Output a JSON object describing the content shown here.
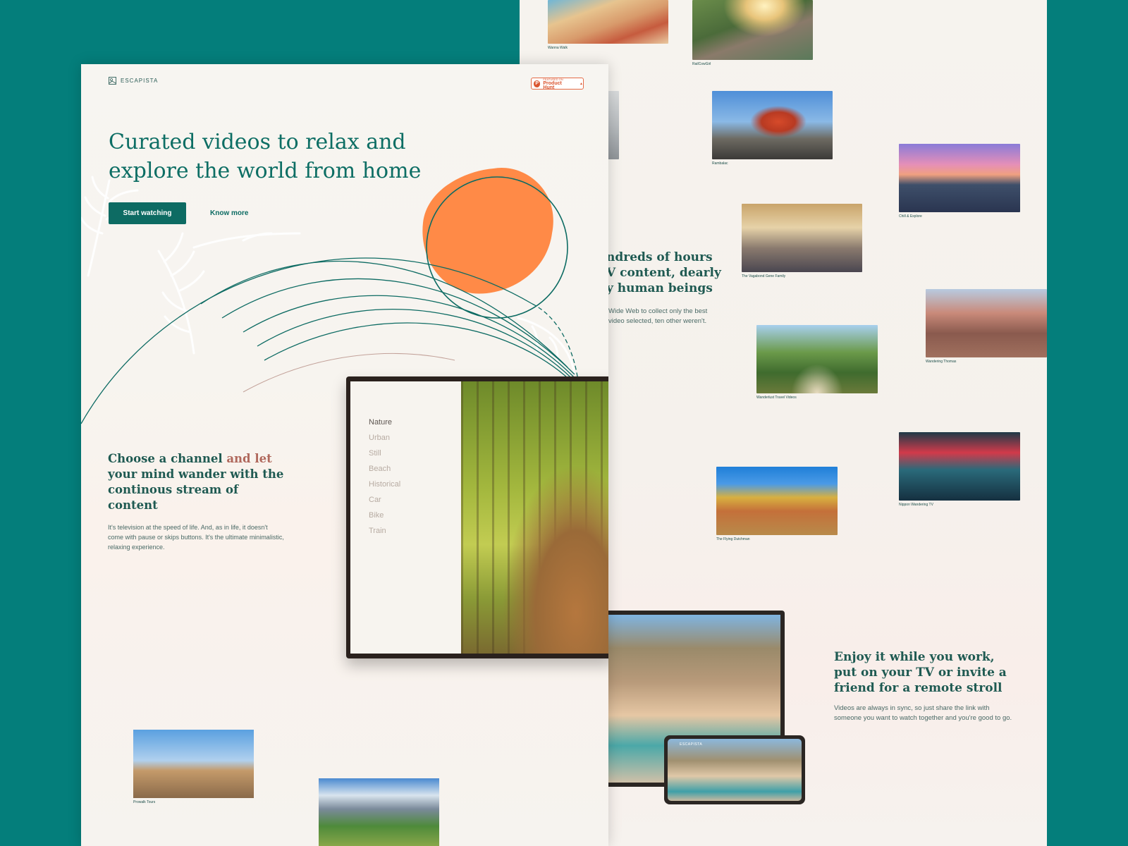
{
  "front": {
    "brand": "ESCAPISTA",
    "product_hunt": {
      "small": "FEATURED ON",
      "big": "Product Hunt",
      "votes": "▲"
    },
    "hero": {
      "title": "Curated videos to relax and explore the world from home",
      "cta_primary": "Start watching",
      "cta_secondary": "Know more"
    },
    "channels_section": {
      "heading_part1": "Choose a channel ",
      "heading_accent": "and let",
      "heading_part2": " your mind wander with the continous stream of content",
      "paragraph": "It's television at the speed of life. And, as in life, it doesn't come with pause or skips buttons. It's the ultimate minimalistic, relaxing experience."
    },
    "channel_menu": [
      "Nature",
      "Urban",
      "Still",
      "Beach",
      "Historical",
      "Car",
      "Bike",
      "Train"
    ],
    "active_channel": "Nature",
    "bottom_thumbs": [
      {
        "caption": "Prowalk Tours"
      },
      {
        "caption": ""
      }
    ]
  },
  "back": {
    "thumbs": [
      {
        "caption": "Wanna Walk"
      },
      {
        "caption": "RailCowGirl"
      },
      {
        "caption": ""
      },
      {
        "caption": "Rambalac"
      },
      {
        "caption": "Chill & Explore"
      },
      {
        "caption": "The Vagabond Gene Family"
      },
      {
        "caption": "Wandering Thomas"
      },
      {
        "caption": "Wanderlust Travel Videos"
      },
      {
        "caption": "Nippon Wandering TV"
      },
      {
        "caption": "The Flying Dutchman"
      }
    ],
    "mid_heading": "ndreds of hours\nV content, dearly\ny human beings",
    "mid_paragraph": "Wide Web to collect only the best\nvideo selected, ten other weren't.",
    "sync_section": {
      "heading": "Enjoy it while you work, put on your TV or invite a friend for a remote stroll",
      "paragraph": "Videos are always in sync, so just share the link with someone you want to watch together and you're good to go."
    },
    "phone_brand": "ESCAPISTA"
  },
  "colors": {
    "background": "#047e7b",
    "brand_green": "#0d6b63",
    "sun_orange": "#ff8a47",
    "accent_rose": "#b0685c"
  }
}
